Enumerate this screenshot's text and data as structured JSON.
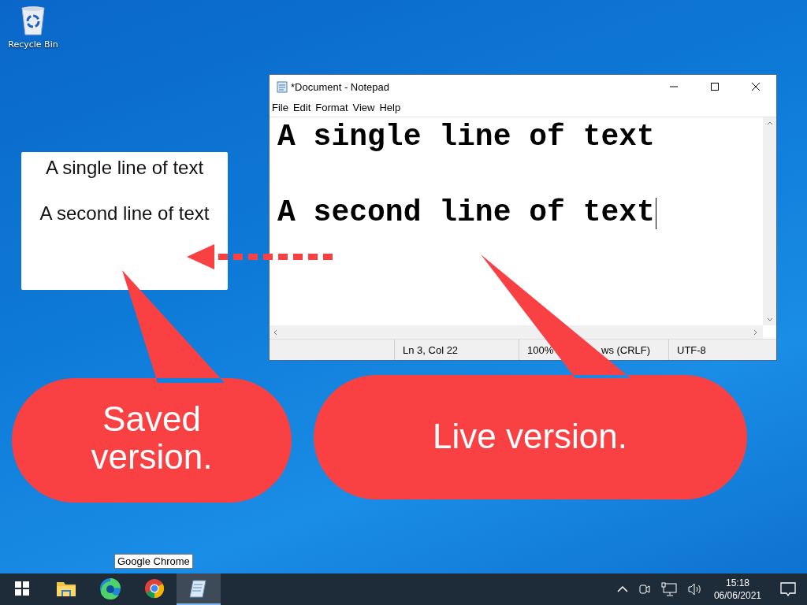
{
  "desktop_icons": [
    {
      "label": "Recycle Bin"
    }
  ],
  "saved_note": {
    "lines": [
      "A single line of text",
      "A second line of text"
    ]
  },
  "notepad": {
    "title": "*Document - Notepad",
    "menu": [
      "File",
      "Edit",
      "Format",
      "View",
      "Help"
    ],
    "lines": [
      {
        "text": "A single line of text",
        "blank_before": false
      },
      {
        "text": "A second line of text",
        "blank_before": true
      }
    ],
    "status": [
      "Ln 3, Col 22",
      "100%",
      "ws (CRLF)",
      "UTF-8"
    ]
  },
  "callouts": [
    {
      "text": "Saved version."
    },
    {
      "text": "Live version."
    }
  ],
  "tooltip": "Google Chrome",
  "taskbar": {
    "apps": [
      {
        "kind": "start",
        "active": false
      },
      {
        "kind": "folder",
        "active": false
      },
      {
        "kind": "edge",
        "active": false
      },
      {
        "kind": "chrome",
        "active": false
      },
      {
        "kind": "notepad",
        "active": true
      }
    ],
    "time": "15:18",
    "date": "06/06/2021"
  }
}
